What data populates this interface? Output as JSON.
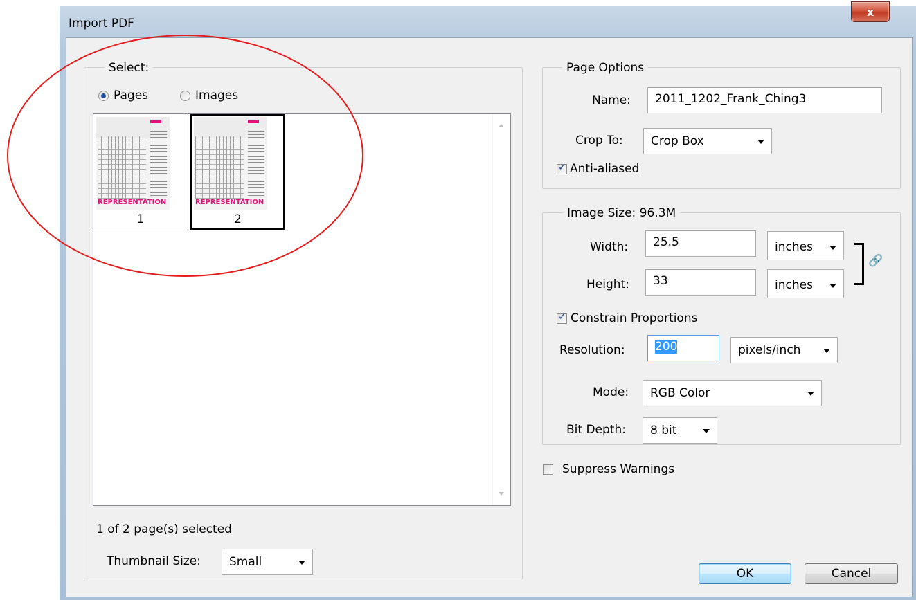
{
  "window": {
    "title": "Import PDF",
    "close_glyph": "x"
  },
  "select_group": {
    "legend": "Select:",
    "radio_pages": "Pages",
    "radio_images": "Images",
    "selected_radio": "Pages",
    "thumbnails": [
      {
        "number": "1",
        "caption": "REPRESENTATION",
        "selected": false
      },
      {
        "number": "2",
        "caption": "REPRESENTATION",
        "selected": true
      }
    ],
    "status": "1 of 2 page(s) selected",
    "thumbnail_size_label": "Thumbnail Size:",
    "thumbnail_size_value": "Small"
  },
  "page_options": {
    "legend": "Page Options",
    "name_label": "Name:",
    "name_value": "2011_1202_Frank_Ching3",
    "crop_label": "Crop To:",
    "crop_value": "Crop Box",
    "anti_aliased_label": "Anti-aliased",
    "anti_aliased_checked": true
  },
  "image_size": {
    "legend": "Image Size: 96.3M",
    "width_label": "Width:",
    "width_value": "25.5",
    "width_unit": "inches",
    "height_label": "Height:",
    "height_value": "33",
    "height_unit": "inches",
    "constrain_label": "Constrain Proportions",
    "constrain_checked": true,
    "resolution_label": "Resolution:",
    "resolution_value": "200",
    "resolution_unit": "pixels/inch",
    "mode_label": "Mode:",
    "mode_value": "RGB Color",
    "bitdepth_label": "Bit Depth:",
    "bitdepth_value": "8 bit"
  },
  "suppress_warnings": {
    "label": "Suppress Warnings",
    "checked": false
  },
  "buttons": {
    "ok": "OK",
    "cancel": "Cancel"
  },
  "colors": {
    "annotation_ellipse": "#e41c1c",
    "thumbnail_accent": "#e0157a",
    "selection_highlight": "#3399ff"
  }
}
